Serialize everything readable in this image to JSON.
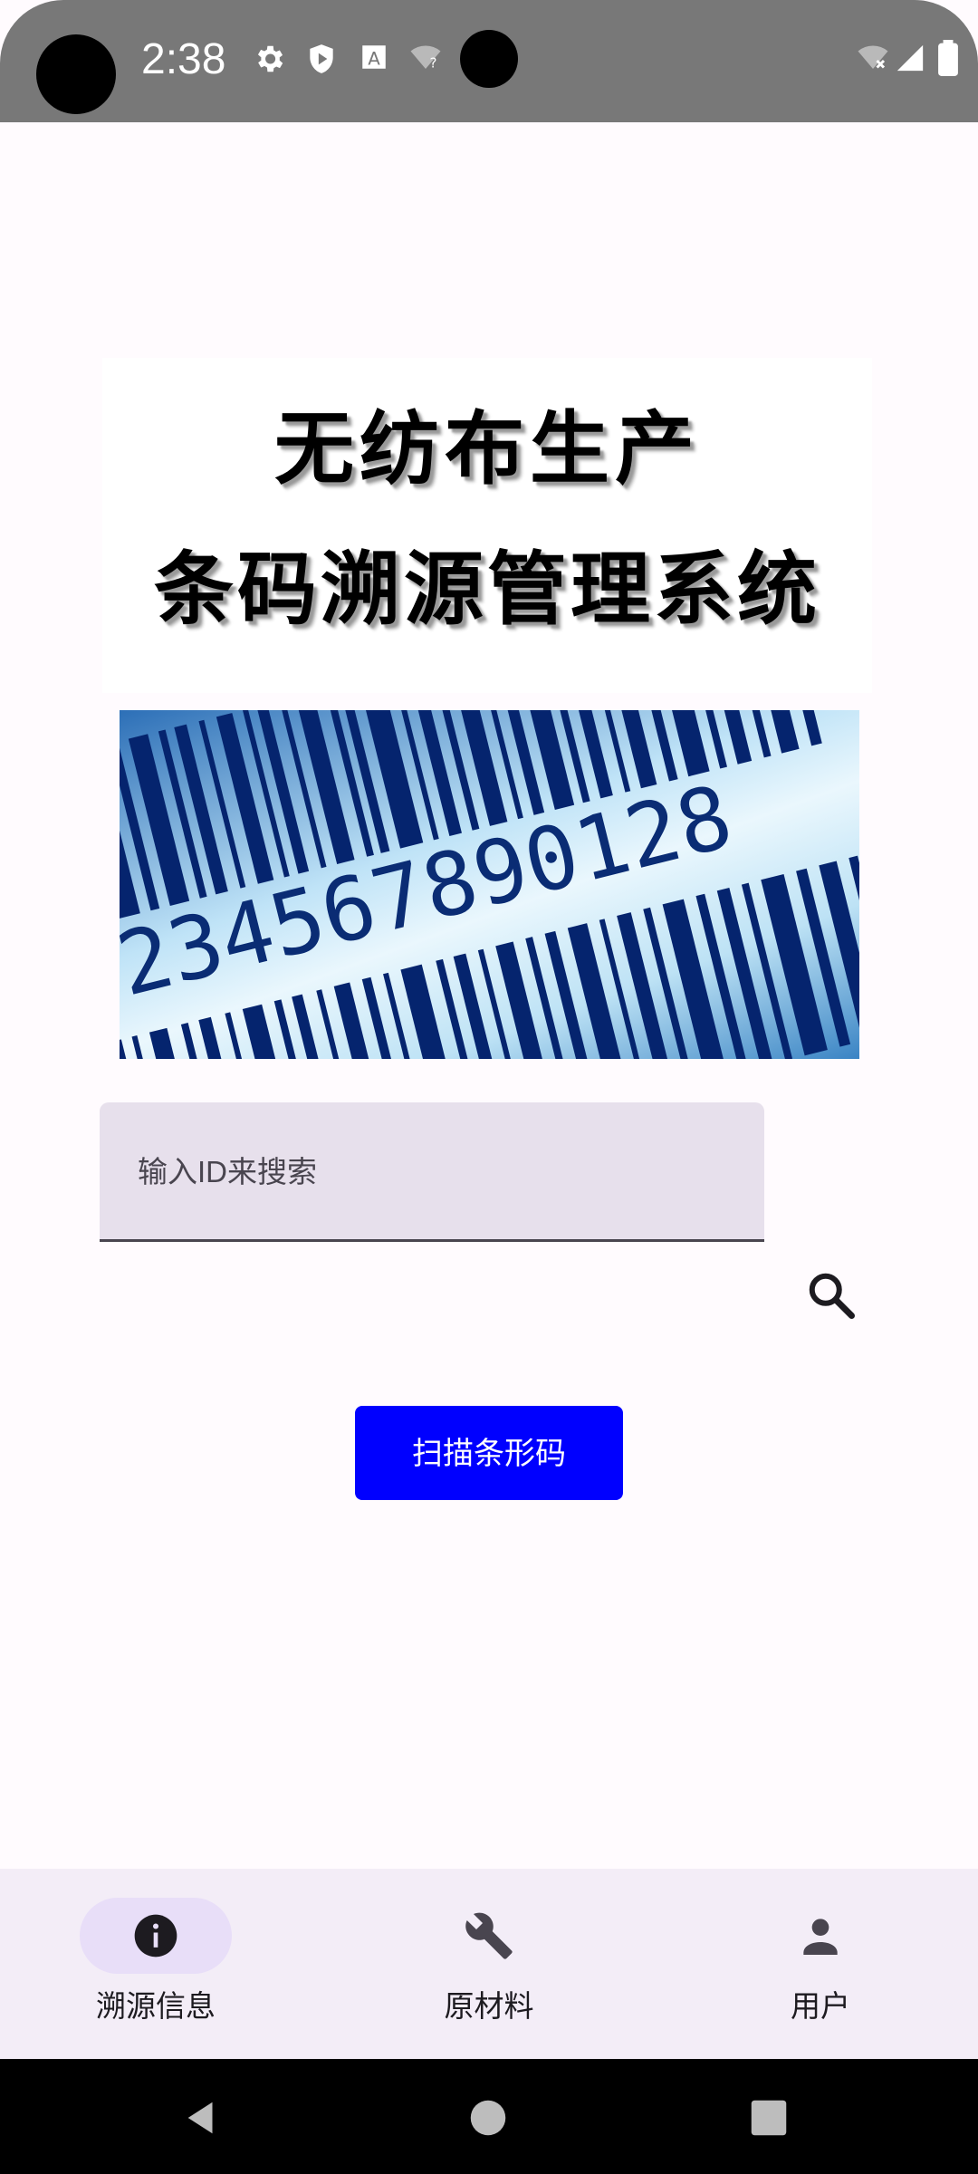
{
  "status_bar": {
    "time": "2:38",
    "icons": [
      "settings-icon",
      "shield-play-icon",
      "text-a-icon",
      "wifi-question-icon",
      "wifi-x-icon",
      "signal-icon",
      "battery-icon"
    ]
  },
  "title": {
    "line1": "无纺布生产",
    "line2": "条码溯源管理系统"
  },
  "barcode_image": {
    "digits": "234567890128"
  },
  "search": {
    "placeholder": "输入ID来搜索",
    "value": ""
  },
  "scan_button": {
    "label": "扫描条形码"
  },
  "bottom_nav": {
    "items": [
      {
        "label": "溯源信息",
        "icon": "info-icon",
        "selected": true
      },
      {
        "label": "原材料",
        "icon": "wrench-icon",
        "selected": false
      },
      {
        "label": "用户",
        "icon": "person-icon",
        "selected": false
      }
    ]
  },
  "system_nav": {
    "buttons": [
      "back-icon",
      "home-icon",
      "recents-icon"
    ]
  },
  "colors": {
    "primary_button": "#0000ff",
    "nav_indicator": "#e8def8",
    "field_bg": "#e7e0ec",
    "background": "#fffbfe"
  }
}
